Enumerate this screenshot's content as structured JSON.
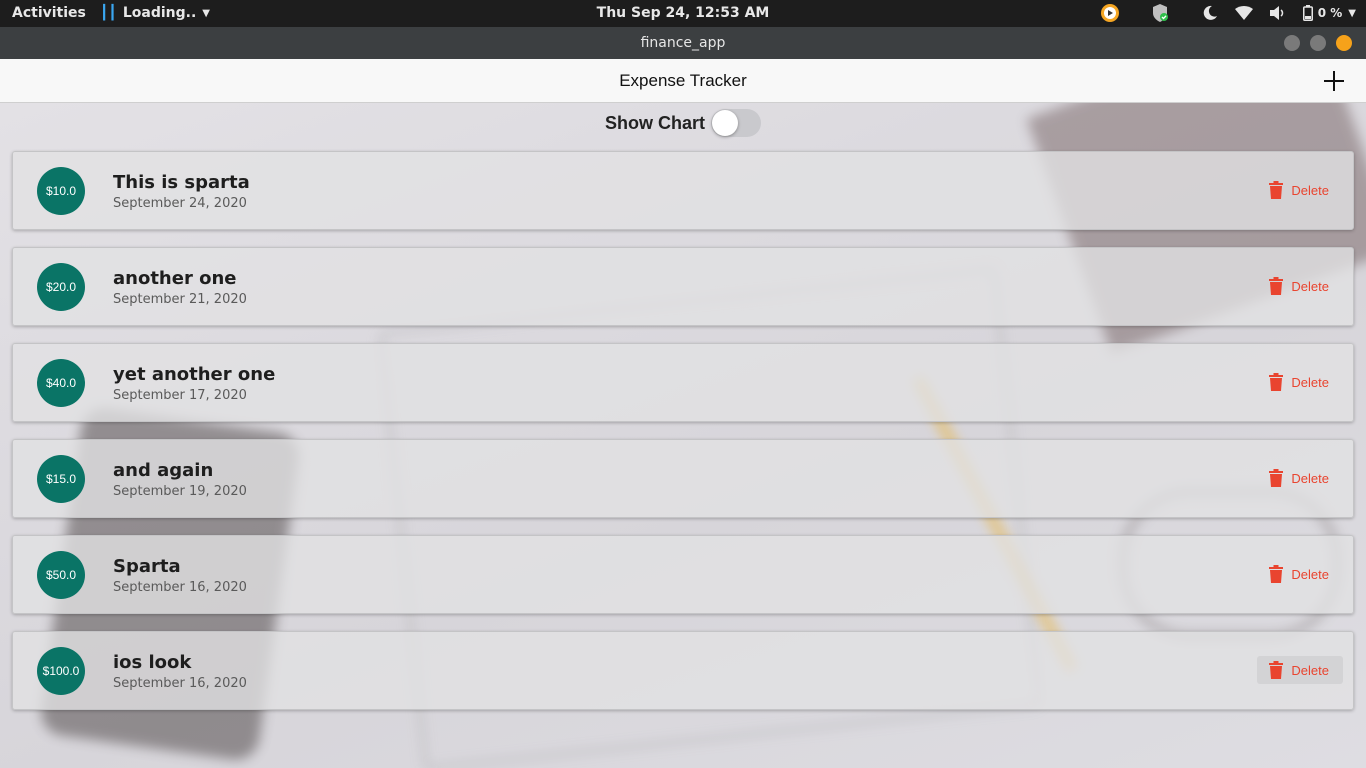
{
  "system_bar": {
    "activities": "Activities",
    "app_menu": "Loading..",
    "clock": "Thu Sep 24, 12:53 AM",
    "battery": "0 %"
  },
  "window": {
    "title": "finance_app"
  },
  "app": {
    "title": "Expense Tracker",
    "show_chart_label": "Show Chart",
    "show_chart_on": false,
    "delete_label": "Delete",
    "accent_color": "#0a7466",
    "delete_color": "#e9442f",
    "transactions": [
      {
        "amount": "$10.0",
        "title": "This is sparta",
        "date": "September 24, 2020"
      },
      {
        "amount": "$20.0",
        "title": "another one",
        "date": "September 21, 2020"
      },
      {
        "amount": "$40.0",
        "title": "yet another one",
        "date": "September 17, 2020"
      },
      {
        "amount": "$15.0",
        "title": "and again",
        "date": "September 19, 2020"
      },
      {
        "amount": "$50.0",
        "title": "Sparta",
        "date": "September 16, 2020"
      },
      {
        "amount": "$100.0",
        "title": "ios look",
        "date": "September 16, 2020"
      }
    ]
  },
  "icons": {
    "app_menu": "app-logo-icon",
    "chevron": "chevron-down-icon",
    "tray": [
      "media-player-icon",
      "shield-icon",
      "night-light-icon",
      "wifi-icon",
      "volume-icon",
      "battery-icon"
    ],
    "add": "plus-icon",
    "delete": "trash-icon"
  }
}
